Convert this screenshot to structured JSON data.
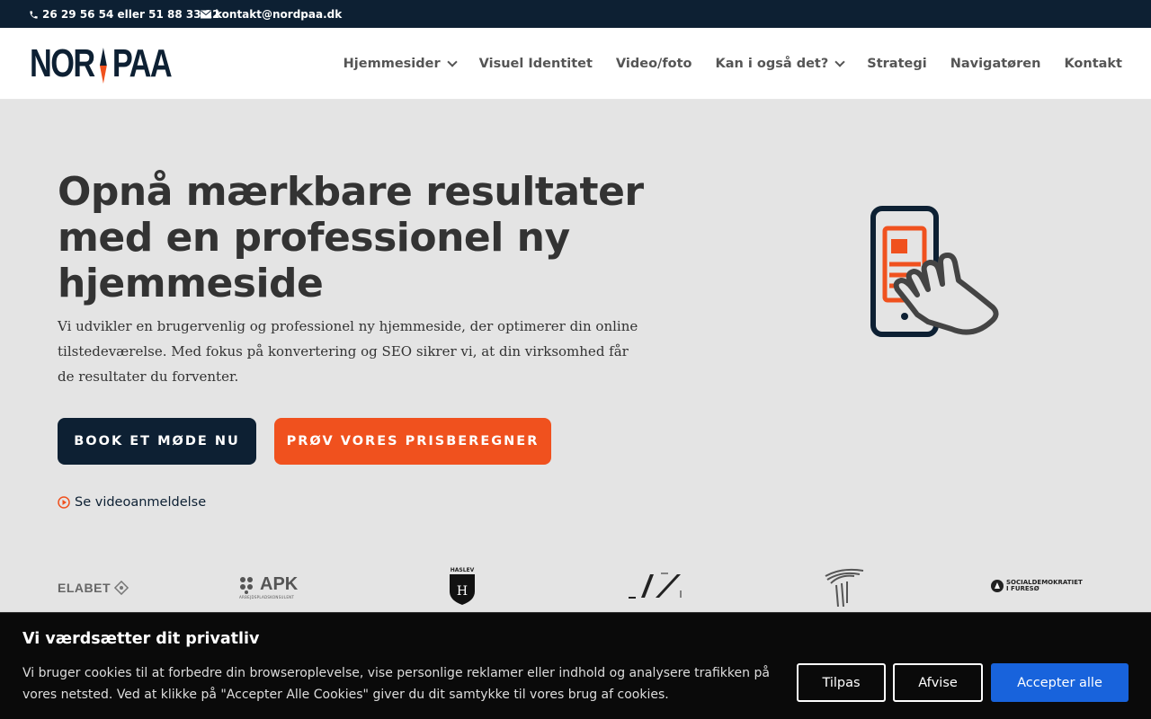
{
  "topbar": {
    "phone": "26 29 56 54 eller 51 88 33 12",
    "email": "kontakt@nordpaa.dk",
    "phone_icon": "phone-icon",
    "email_icon": "envelope-icon"
  },
  "logo": {
    "left": "NOR",
    "right": "PAA"
  },
  "nav": {
    "items": [
      {
        "label": "Hjemmesider",
        "dropdown": true
      },
      {
        "label": "Visuel Identitet",
        "dropdown": false
      },
      {
        "label": "Video/foto",
        "dropdown": false
      },
      {
        "label": "Kan i også det?",
        "dropdown": true
      },
      {
        "label": "Strategi",
        "dropdown": false
      },
      {
        "label": "Navigatøren",
        "dropdown": false
      },
      {
        "label": "Kontakt",
        "dropdown": false
      }
    ]
  },
  "hero": {
    "title": "Opnå mærkbare resultater med en professionel ny hjemmeside",
    "text": "Vi udvikler en brugervenlig og professionel ny hjemmeside, der optimerer din online tilstedeværelse. Med fokus på konvertering og SEO sikrer vi, at din virksomhed får de resultater du forventer.",
    "btn_book": "BOOK ET MØDE NU",
    "btn_price": "PRØV VORES PRISBEREGNER",
    "video_link": "Se videoanmeldelse",
    "illustration_icon": "phone-touch-icon"
  },
  "partners": {
    "elabet": "ELABET",
    "apk": "APK",
    "apk_sub": "ARBEJDSPLADSKONSULENT",
    "hasley": "HASLEV",
    "soc_line1": "SOCIALDEMOKRATIET",
    "soc_line2": "I FURESØ"
  },
  "cookie": {
    "title": "Vi værdsætter dit privatliv",
    "text": "Vi bruger cookies til at forbedre din browseroplevelse, vise personlige reklamer eller indhold og analysere trafikken på vores netsted. Ved at klikke på \"Accepter Alle Cookies\" giver du dit samtykke til vores brug af cookies.",
    "btn_customize": "Tilpas",
    "btn_reject": "Afvise",
    "btn_accept": "Accepter alle"
  },
  "colors": {
    "navy": "#0d2033",
    "orange": "#f0511e",
    "accept_blue": "#1863dc",
    "hero_bg": "#e4e4e4"
  }
}
